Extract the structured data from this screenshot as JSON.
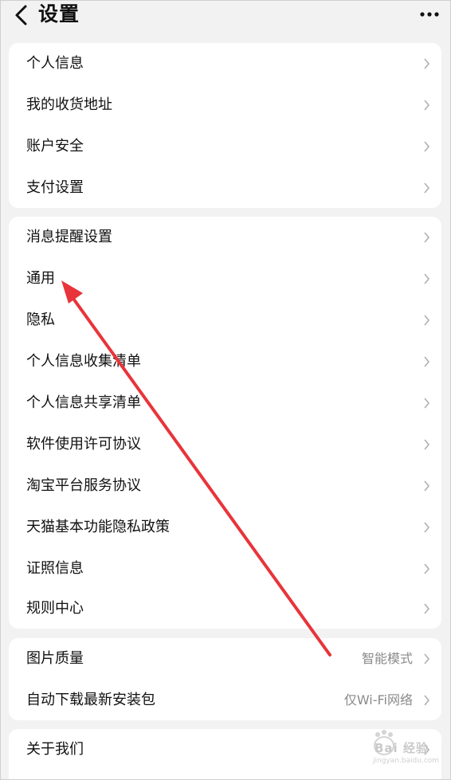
{
  "header": {
    "title": "设置",
    "back_icon": "chevron-left-icon",
    "more_icon": "more-horizontal-icon"
  },
  "groups": [
    {
      "items": [
        {
          "label": "个人信息"
        },
        {
          "label": "我的收货地址"
        },
        {
          "label": "账户安全"
        },
        {
          "label": "支付设置"
        }
      ]
    },
    {
      "items": [
        {
          "label": "消息提醒设置"
        },
        {
          "label": "通用"
        },
        {
          "label": "隐私"
        },
        {
          "label": "个人信息收集清单"
        },
        {
          "label": "个人信息共享清单"
        },
        {
          "label": "软件使用许可协议"
        },
        {
          "label": "淘宝平台服务协议"
        },
        {
          "label": "天猫基本功能隐私政策"
        },
        {
          "label": "证照信息"
        },
        {
          "label": "规则中心"
        }
      ]
    },
    {
      "items": [
        {
          "label": "图片质量",
          "value": "智能模式"
        },
        {
          "label": "自动下载最新安装包",
          "value": "仅Wi-Fi网络"
        }
      ]
    },
    {
      "items": [
        {
          "label": "关于我们"
        }
      ]
    }
  ],
  "annotation": {
    "type": "arrow",
    "color": "#e8343a",
    "target": "通用"
  },
  "watermark": {
    "text": "Bai 经验",
    "sub": "jingyan.baidu.com"
  },
  "colors": {
    "background": "#f2f2f2",
    "card": "#ffffff",
    "secondary_text": "#8a8a8a",
    "chevron": "#b0b0b0"
  }
}
